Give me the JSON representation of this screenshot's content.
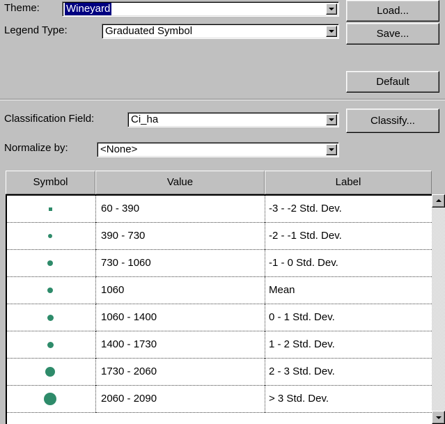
{
  "theme": {
    "label": "Theme:",
    "value": "Wineyard"
  },
  "legend_type": {
    "label": "Legend Type:",
    "value": "Graduated Symbol"
  },
  "buttons": {
    "load": "Load...",
    "save": "Save...",
    "default": "Default",
    "classify": "Classify..."
  },
  "classification_field": {
    "label": "Classification Field:",
    "value": "Ci_ha"
  },
  "normalize_by": {
    "label": "Normalize by:",
    "value": "<None>"
  },
  "grid": {
    "headers": {
      "symbol": "Symbol",
      "value": "Value",
      "label": "Label"
    },
    "symbol_color": "#2e8b6a",
    "rows": [
      {
        "value": "60 - 390",
        "label": "-3 - -2 Std. Dev.",
        "symbol_size": 1
      },
      {
        "value": "390 - 730",
        "label": "-2 - -1 Std. Dev.",
        "symbol_size": 2
      },
      {
        "value": "730 - 1060",
        "label": "-1 - 0 Std. Dev.",
        "symbol_size": 3
      },
      {
        "value": "1060",
        "label": "Mean",
        "symbol_size": 3
      },
      {
        "value": "1060 - 1400",
        "label": "0 - 1 Std. Dev.",
        "symbol_size": 4
      },
      {
        "value": "1400 - 1730",
        "label": "1 - 2 Std. Dev.",
        "symbol_size": 4
      },
      {
        "value": "1730 - 2060",
        "label": "2 - 3 Std. Dev.",
        "symbol_size": 5
      },
      {
        "value": "2060 - 2090",
        "label": "> 3 Std. Dev.",
        "symbol_size": 6
      }
    ]
  }
}
